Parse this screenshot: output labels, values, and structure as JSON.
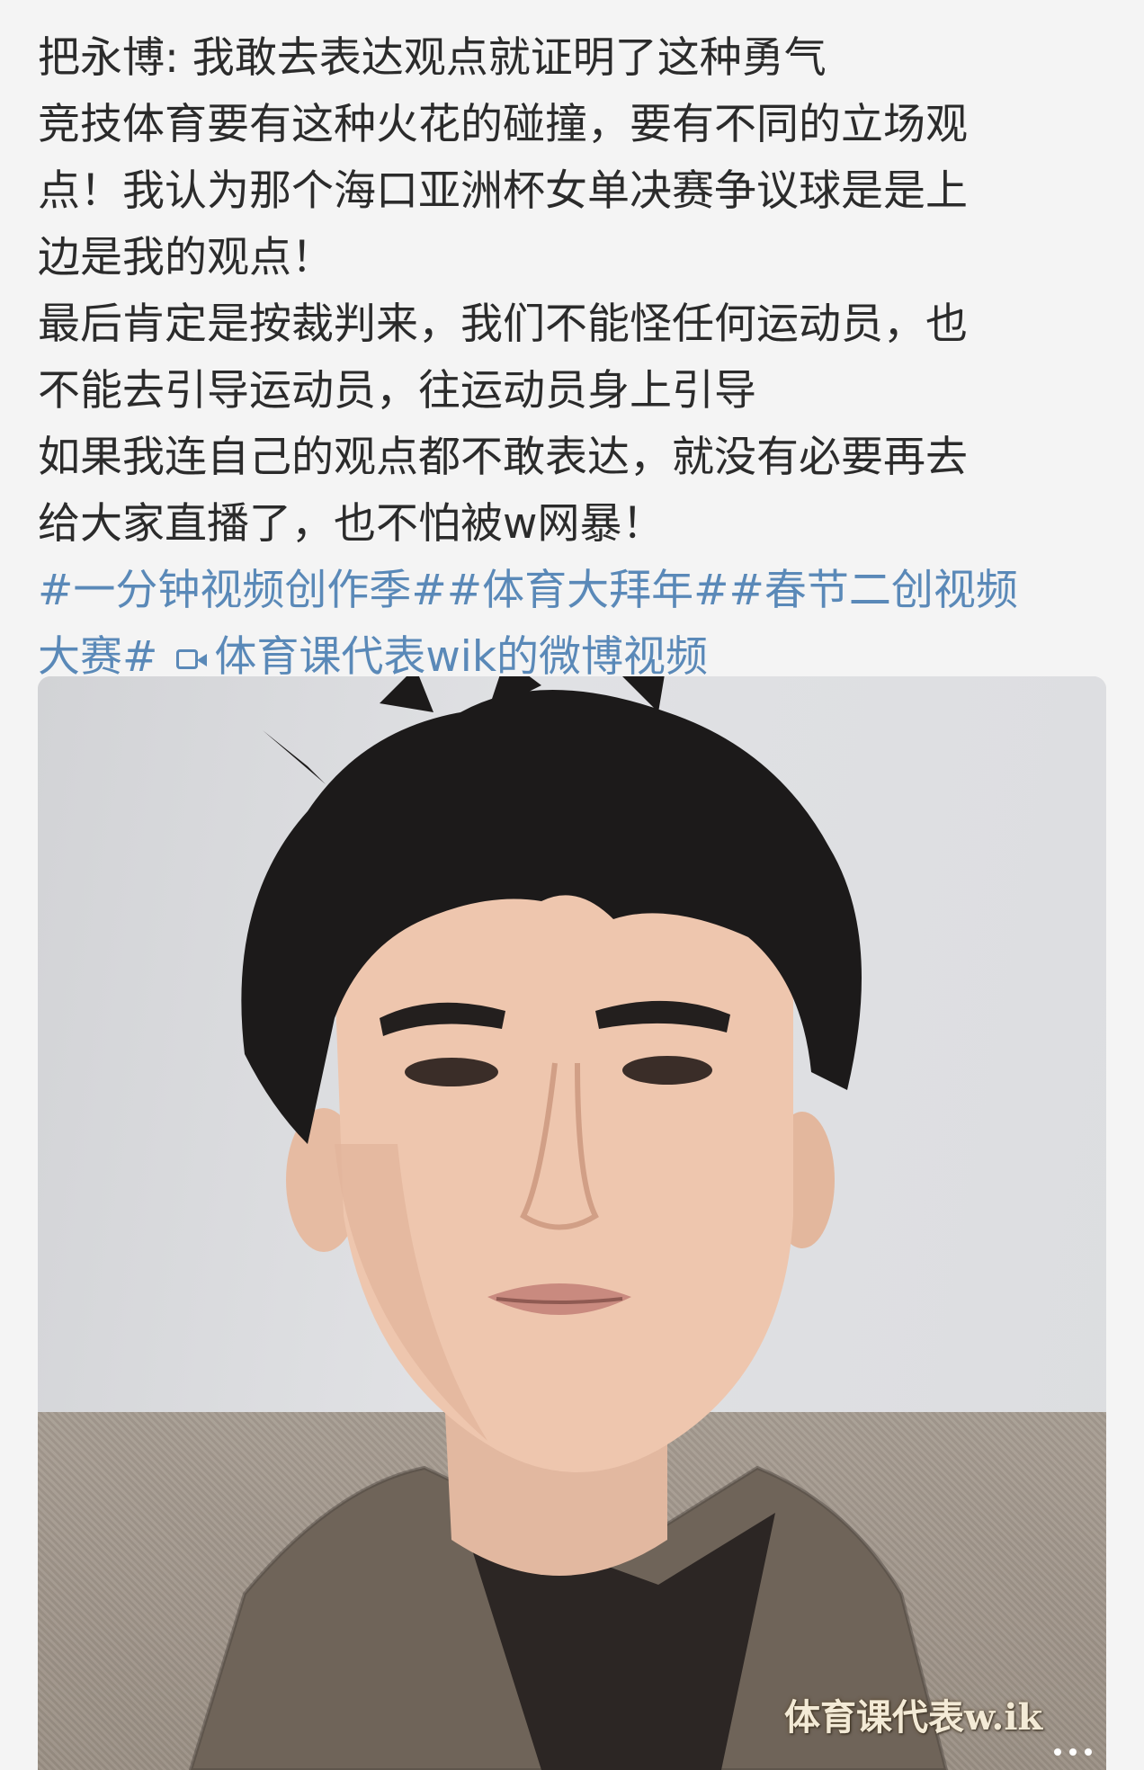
{
  "post": {
    "lines": [
      "把永博: 我敢去表达观点就证明了这种勇气",
      "竞技体育要有这种火花的碰撞，要有不同的立场观",
      "点！我认为那个海口亚洲杯女单决赛争议球是是上",
      "边是我的观点！",
      "最后肯定是按裁判来，我们不能怪任何运动员，也",
      "不能去引导运动员，往运动员身上引导",
      "如果我连自己的观点都不敢表达，就没有必要再去",
      "给大家直播了，也不怕被w网暴！"
    ],
    "topics_line1": "#一分钟视频创作季##体育大拜年##春节二创视频",
    "topics_line2": "大赛#",
    "video_link_label": "体育课代表wik的微博视频",
    "video_link_icon": "video-camera-icon"
  },
  "video": {
    "watermark": "体育课代表w.ik",
    "more_icon": "more-dots-icon"
  },
  "colors": {
    "background": "#f4f4f4",
    "text": "#2b2b2b",
    "link": "#5a89b8"
  }
}
